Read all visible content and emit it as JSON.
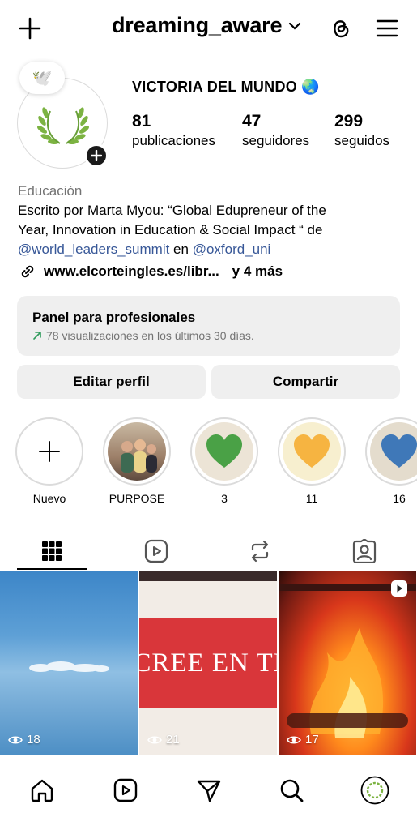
{
  "header": {
    "username": "dreaming_aware",
    "icons": [
      "plus-icon",
      "chevron-down-icon",
      "threads-icon",
      "menu-icon"
    ]
  },
  "profile": {
    "full_name": "VICTORIA DEL MUNDO 🌏",
    "note_emoji": "🕊️",
    "stats": [
      {
        "value": "81",
        "label": "publicaciones"
      },
      {
        "value": "47",
        "label": "seguidores"
      },
      {
        "value": "299",
        "label": "seguido​s"
      }
    ],
    "category": "Educación",
    "bio": {
      "line1": "Escrito por Marta Myou:  “Global Edupreneur of the",
      "line2": "Year, Innovation in Education & Social Impact “ de",
      "mention1": "@world_leaders_summit",
      "connector": " en ",
      "mention2": "@oxford_uni"
    },
    "link": {
      "url": "www.elcorteingles.es/libr...",
      "more": "y 4 más"
    }
  },
  "pro_panel": {
    "title": "Panel para profesionales",
    "subtitle": "78 visualizaciones en los últimos 30 días."
  },
  "actions": {
    "edit": "Editar perfil",
    "share": "Compartir"
  },
  "highlights": [
    {
      "label": "Nuevo"
    },
    {
      "label": "PURPOSE"
    },
    {
      "label": "3",
      "color": "#4aa146"
    },
    {
      "label": "11",
      "color": "#f6b441"
    },
    {
      "label": "16",
      "color": "#3f78b8"
    }
  ],
  "posts": [
    {
      "views": "18"
    },
    {
      "views": "21",
      "text": "CREE EN TI"
    },
    {
      "views": "17"
    }
  ],
  "colors": {
    "accent_link": "#385898",
    "muted": "#737373",
    "panel_bg": "#efefef"
  }
}
